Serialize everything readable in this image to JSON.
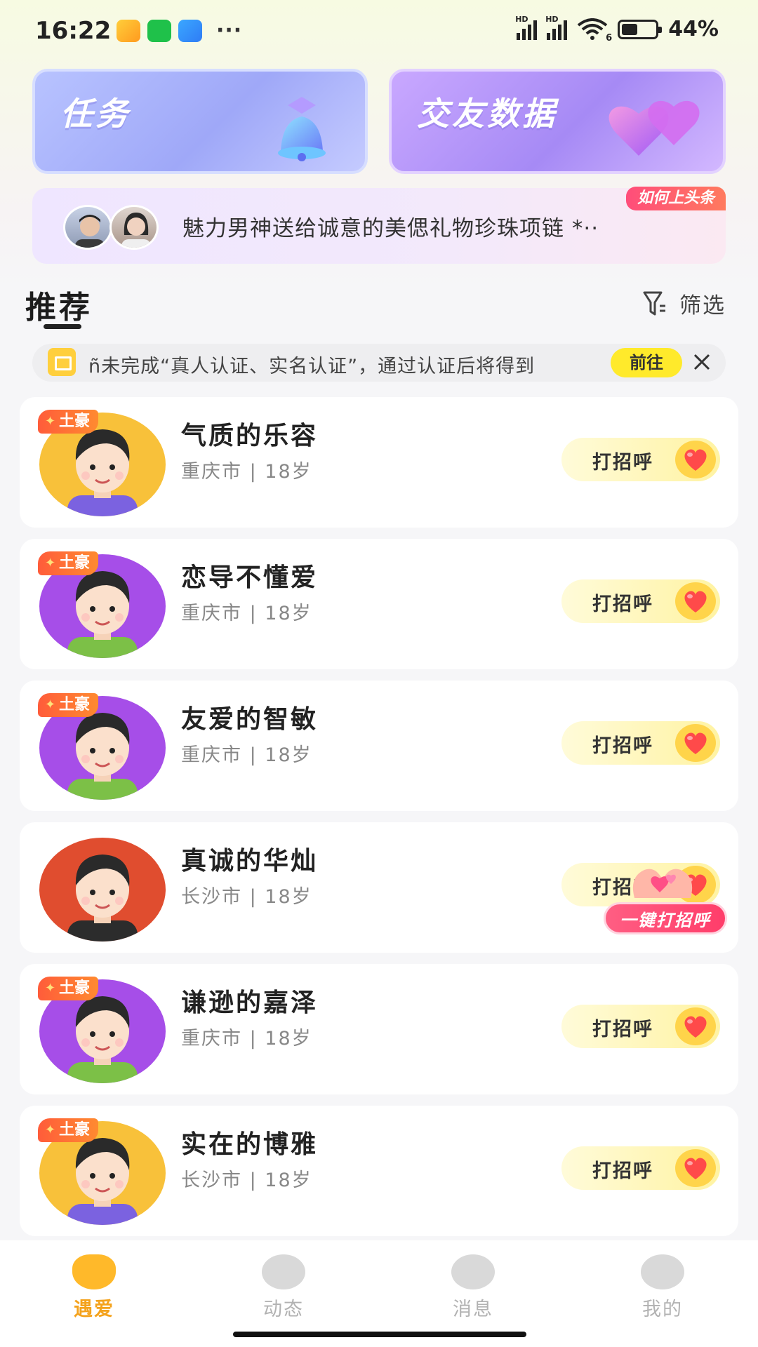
{
  "status_bar": {
    "time": "16:22",
    "signal_label_1": "HD",
    "signal_label_2": "HD",
    "wifi_sub": "6",
    "battery": "44%",
    "more": "···"
  },
  "top_cards": {
    "task_label": "任务",
    "data_label": "交友数据"
  },
  "headline": {
    "tag": "如何上头条",
    "text": "魅力男神送给诚意的美偲礼物珍珠项链 *··"
  },
  "section": {
    "title": "推荐",
    "filter_label": "筛选"
  },
  "notice": {
    "text": "ñ未完成“真人认证、实名认证”，通过认证后将得到",
    "action": "前往"
  },
  "users": [
    {
      "name": "气质的乐容",
      "city": "重庆市",
      "age": "18岁",
      "badge": "土豪",
      "avatar_bg": "#f8c13a",
      "shirt": "#7b62e0",
      "hair": "#2a2a2a"
    },
    {
      "name": "恋导不懂爱",
      "city": "重庆市",
      "age": "18岁",
      "badge": "土豪",
      "avatar_bg": "#a64ee8",
      "shirt": "#7cc047",
      "hair": "#2a2a2a"
    },
    {
      "name": "友爱的智敏",
      "city": "重庆市",
      "age": "18岁",
      "badge": "土豪",
      "avatar_bg": "#a64ee8",
      "shirt": "#7cc047",
      "hair": "#2a2a2a"
    },
    {
      "name": "真诚的华灿",
      "city": "长沙市",
      "age": "18岁",
      "badge": "",
      "avatar_bg": "#e04d2f",
      "shirt": "#2c2c2c",
      "hair": "#2a2a2a"
    },
    {
      "name": "谦逊的嘉泽",
      "city": "重庆市",
      "age": "18岁",
      "badge": "土豪",
      "avatar_bg": "#a64ee8",
      "shirt": "#7cc047",
      "hair": "#2a2a2a"
    },
    {
      "name": "实在的博雅",
      "city": "长沙市",
      "age": "18岁",
      "badge": "土豪",
      "avatar_bg": "#f8c13a",
      "shirt": "#7b62e0",
      "hair": "#2a2a2a"
    }
  ],
  "greet_label": "打招呼",
  "meta_separator": "|",
  "one_key_greet": "一键打招呼",
  "tabs": [
    {
      "label": "遇爱",
      "active": true,
      "icon": "heart-face-icon"
    },
    {
      "label": "动态",
      "active": false,
      "icon": "planet-icon"
    },
    {
      "label": "消息",
      "active": false,
      "icon": "chat-bubble-icon"
    },
    {
      "label": "我的",
      "active": false,
      "icon": "profile-icon"
    }
  ],
  "colors": {
    "accent_yellow": "#ffea2b",
    "active_tab": "#f4a21c",
    "badge_red": "#ff5c3a"
  }
}
